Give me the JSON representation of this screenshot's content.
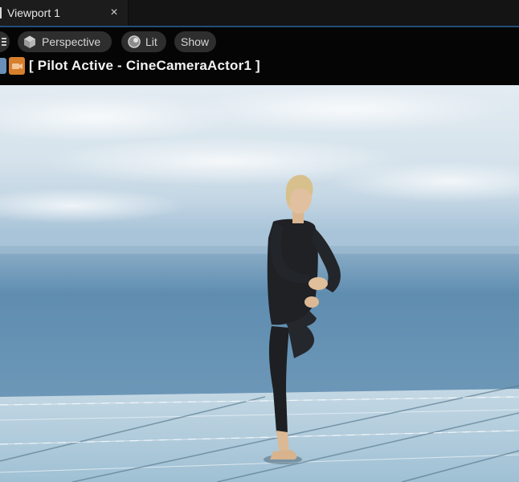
{
  "tab": {
    "title": "Viewport 1",
    "close_glyph": "×"
  },
  "toolbar": {
    "menu_icon": "hamburger-menu-icon",
    "perspective_label": "Perspective",
    "perspective_icon": "cube-icon",
    "lit_label": "Lit",
    "lit_icon": "sphere-shading-icon",
    "show_label": "Show"
  },
  "pilot": {
    "text": "[ Pilot Active - CineCameraActor1 ]",
    "icons": [
      "actor-icon",
      "camera-icon"
    ]
  },
  "colors": {
    "accent": "#1f4f7a",
    "pilot_icon": "#d77f2c",
    "sky_top": "#dbe6ee",
    "sea": "#5f8db0",
    "floor": "#a9c7d8"
  }
}
